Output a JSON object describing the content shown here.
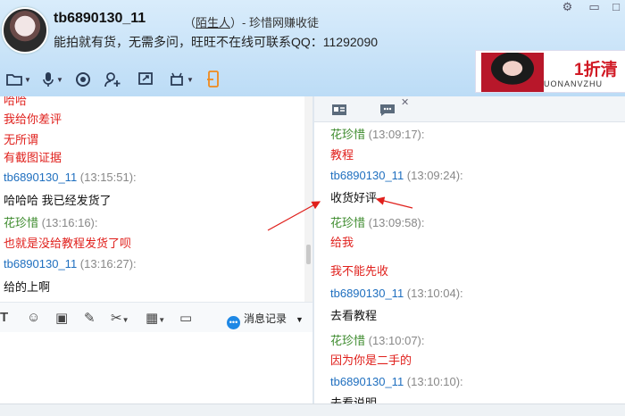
{
  "header": {
    "nickname": "tb6890130_11",
    "relation_open": "（",
    "relation": "陌生人",
    "relation_close": "）- 珍惜网赚收徒",
    "status": "能拍就有货，无需多问，旺旺不在线可联系QQ：11292090"
  },
  "banner": {
    "brand": "1折清",
    "sub": "UONANVZHU"
  },
  "toolbar_icons": [
    "folder-icon",
    "microphone-icon",
    "camera-icon",
    "add-contact-icon",
    "screen-share-icon",
    "robot-icon",
    "mobile-icon"
  ],
  "left_chat": {
    "lines": [
      {
        "text": "哈哈",
        "cls": "red"
      },
      {
        "text": "我给你差评",
        "cls": "red"
      },
      {
        "text": "无所谓",
        "cls": "red"
      },
      {
        "text": "有截图证据",
        "cls": "red"
      },
      {
        "sender": "tb6890130_11",
        "time": "(13:15:51):",
        "cls": "me"
      },
      {
        "text": "哈哈哈   我已经发货了",
        "cls": "black"
      },
      {
        "sender": "花珍惜",
        "time": "(13:16:16):",
        "cls": "other"
      },
      {
        "text": "也就是没给教程发货了呗",
        "cls": "red"
      },
      {
        "sender": "tb6890130_11",
        "time": "(13:16:27):",
        "cls": "me"
      },
      {
        "text": "给的上啊",
        "cls": "black"
      }
    ]
  },
  "edit_toolbar": {
    "history_label": "消息记录"
  },
  "right_chat": {
    "lines": [
      {
        "sender": "花珍惜",
        "time": "(13:09:17):",
        "cls": "other"
      },
      {
        "text": "教程",
        "cls": "red"
      },
      {
        "sender": "tb6890130_11",
        "time": "(13:09:24):",
        "cls": "me"
      },
      {
        "text": "收货好评",
        "cls": "black"
      },
      {
        "sender": "花珍惜",
        "time": "(13:09:58):",
        "cls": "other"
      },
      {
        "text": "给我",
        "cls": "red"
      },
      {
        "text": "我不能先收",
        "cls": "red"
      },
      {
        "sender": "tb6890130_11",
        "time": "(13:10:04):",
        "cls": "me"
      },
      {
        "text": "去看教程",
        "cls": "black"
      },
      {
        "sender": "花珍惜",
        "time": "(13:10:07):",
        "cls": "other"
      },
      {
        "text": "因为你是二手的",
        "cls": "red"
      },
      {
        "sender": "tb6890130_11",
        "time": "(13:10:10):",
        "cls": "me"
      },
      {
        "text": "去看说明",
        "cls": "black"
      }
    ]
  },
  "colors": {
    "accent": "#1f6fbf",
    "other": "#3c8a2c",
    "alert": "#e0201c"
  }
}
